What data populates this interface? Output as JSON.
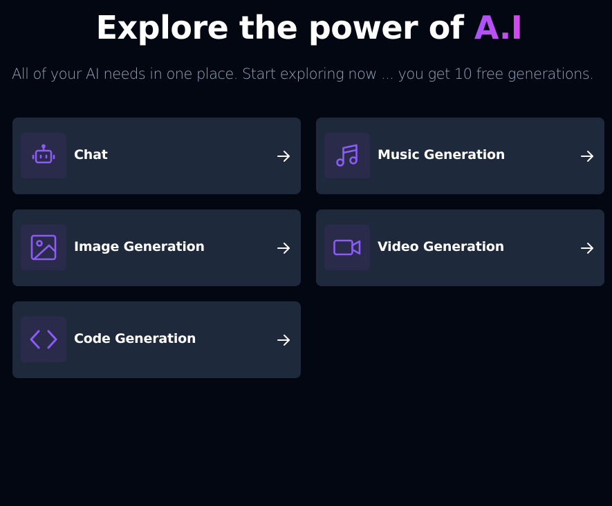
{
  "header": {
    "title_prefix": "Explore the power of ",
    "title_accent": "A.I",
    "subtitle": "All of your AI needs in one place. Start exploring now ... you get 10 free generations."
  },
  "tools": [
    {
      "label": "Chat",
      "icon": "robot-icon"
    },
    {
      "label": "Music Generation",
      "icon": "music-note-icon"
    },
    {
      "label": "Image Generation",
      "icon": "image-icon"
    },
    {
      "label": "Video Generation",
      "icon": "video-camera-icon"
    },
    {
      "label": "Code Generation",
      "icon": "code-icon"
    }
  ],
  "colors": {
    "background": "#030712",
    "card": "#1e293b",
    "icon_bg": "#2a2a4a",
    "icon_stroke": "#8b5cf6",
    "accent_start": "#a855f7",
    "accent_end": "#d946ef",
    "subtitle": "#94a3b8"
  }
}
